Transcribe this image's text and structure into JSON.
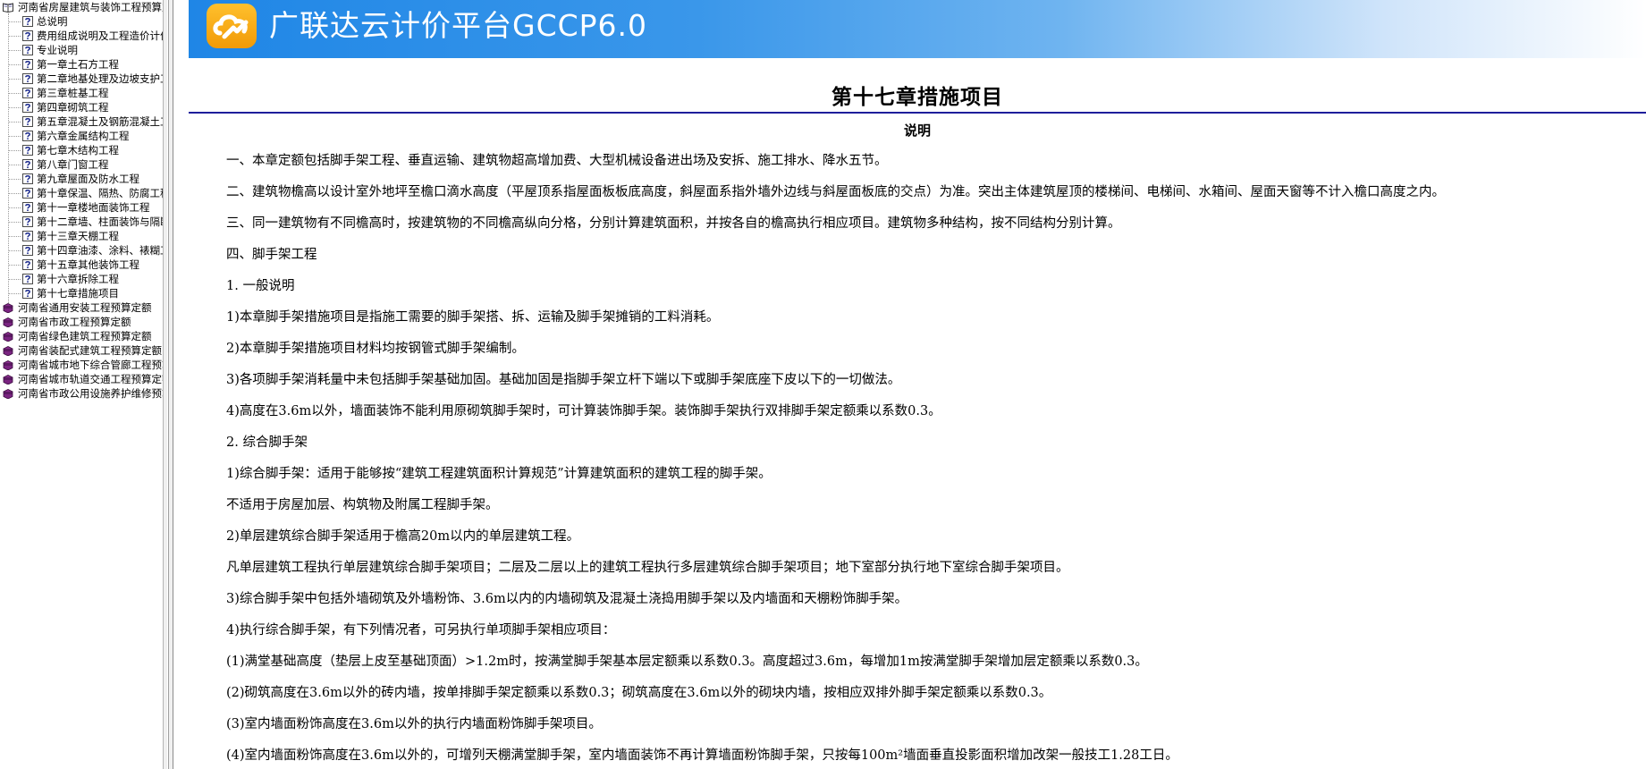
{
  "app": {
    "title": "广联达云计价平台GCCP6.0",
    "accent_color": "#1f86e6",
    "logo_color": "#f5a30f"
  },
  "tree": {
    "root": {
      "label": "河南省房屋建筑与装饰工程预算定额",
      "icon": "open-book-icon"
    },
    "items": [
      {
        "label": "总说明",
        "icon": "help-page-icon"
      },
      {
        "label": "费用组成说明及工程造价计价程序",
        "icon": "help-page-icon"
      },
      {
        "label": "专业说明",
        "icon": "help-page-icon"
      },
      {
        "label": "第一章土石方工程",
        "icon": "help-page-icon"
      },
      {
        "label": "第二章地基处理及边坡支护工程",
        "icon": "help-page-icon"
      },
      {
        "label": "第三章桩基工程",
        "icon": "help-page-icon"
      },
      {
        "label": "第四章砌筑工程",
        "icon": "help-page-icon"
      },
      {
        "label": "第五章混凝土及钢筋混凝土工程",
        "icon": "help-page-icon"
      },
      {
        "label": "第六章金属结构工程",
        "icon": "help-page-icon"
      },
      {
        "label": "第七章木结构工程",
        "icon": "help-page-icon"
      },
      {
        "label": "第八章门窗工程",
        "icon": "help-page-icon"
      },
      {
        "label": "第九章屋面及防水工程",
        "icon": "help-page-icon"
      },
      {
        "label": "第十章保温、隔热、防腐工程",
        "icon": "help-page-icon"
      },
      {
        "label": "第十一章楼地面装饰工程",
        "icon": "help-page-icon"
      },
      {
        "label": "第十二章墙、柱面装饰与隔断工程",
        "icon": "help-page-icon"
      },
      {
        "label": "第十三章天棚工程",
        "icon": "help-page-icon"
      },
      {
        "label": "第十四章油漆、涂料、裱糊工程",
        "icon": "help-page-icon"
      },
      {
        "label": "第十五章其他装饰工程",
        "icon": "help-page-icon"
      },
      {
        "label": "第十六章拆除工程",
        "icon": "help-page-icon"
      },
      {
        "label": "第十七章措施项目",
        "icon": "help-page-icon"
      }
    ],
    "books": [
      {
        "label": "河南省通用安装工程预算定额",
        "icon": "book-icon"
      },
      {
        "label": "河南省市政工程预算定额",
        "icon": "book-icon"
      },
      {
        "label": "河南省绿色建筑工程预算定额",
        "icon": "book-icon"
      },
      {
        "label": "河南省装配式建筑工程预算定额",
        "icon": "book-icon"
      },
      {
        "label": "河南省城市地下综合管廊工程预算定额",
        "icon": "book-icon"
      },
      {
        "label": "河南省城市轨道交通工程预算定额",
        "icon": "book-icon"
      },
      {
        "label": "河南省市政公用设施养护维修预算定额",
        "icon": "book-icon"
      }
    ]
  },
  "document": {
    "chapter_title": "第十七章措施项目",
    "section_heading": "说明",
    "paragraphs": [
      "一、本章定额包括脚手架工程、垂直运输、建筑物超高增加费、大型机械设备进出场及安拆、施工排水、降水五节。",
      "二、建筑物檐高以设计室外地坪至檐口滴水高度（平屋顶系指屋面板板底高度，斜屋面系指外墙外边线与斜屋面板底的交点）为准。突出主体建筑屋顶的楼梯间、电梯间、水箱间、屋面天窗等不计入檐口高度之内。",
      "三、同一建筑物有不同檐高时，按建筑物的不同檐高纵向分格，分别计算建筑面积，并按各自的檐高执行相应项目。建筑物多种结构，按不同结构分别计算。",
      "四、脚手架工程",
      "1. 一般说明",
      "1)本章脚手架措施项目是指施工需要的脚手架搭、拆、运输及脚手架摊销的工料消耗。",
      "2)本章脚手架措施项目材料均按钢管式脚手架编制。",
      "3)各项脚手架消耗量中未包括脚手架基础加固。基础加固是指脚手架立杆下端以下或脚手架底座下皮以下的一切做法。",
      "4)高度在3.6m以外，墙面装饰不能利用原砌筑脚手架时，可计算装饰脚手架。装饰脚手架执行双排脚手架定额乘以系数0.3。",
      "2. 综合脚手架",
      "1)综合脚手架：适用于能够按“建筑工程建筑面积计算规范”计算建筑面积的建筑工程的脚手架。",
      "不适用于房屋加层、构筑物及附属工程脚手架。",
      "2)单层建筑综合脚手架适用于檐高20m以内的单层建筑工程。",
      "凡单层建筑工程执行单层建筑综合脚手架项目；二层及二层以上的建筑工程执行多层建筑综合脚手架项目；地下室部分执行地下室综合脚手架项目。",
      "3)综合脚手架中包括外墙砌筑及外墙粉饰、3.6m以内的内墙砌筑及混凝土浇捣用脚手架以及内墙面和天棚粉饰脚手架。",
      "4)执行综合脚手架，有下列情况者，可另执行单项脚手架相应项目：",
      "(1)满堂基础高度（垫层上皮至基础顶面）>1.2m时，按满堂脚手架基本层定额乘以系数0.3。高度超过3.6m，每增加1m按满堂脚手架增加层定额乘以系数0.3。",
      "(2)砌筑高度在3.6m以外的砖内墙，按单排脚手架定额乘以系数0.3；砌筑高度在3.6m以外的砌块内墙，按相应双排外脚手架定额乘以系数0.3。",
      "(3)室内墙面粉饰高度在3.6m以外的执行内墙面粉饰脚手架项目。",
      "(4)室内墙面粉饰高度在3.6m以外的，可增列天棚满堂脚手架，室内墙面装饰不再计算墙面粉饰脚手架，只按每100m²墙面垂直投影面积增加改架一般技工1.28工日。"
    ]
  }
}
